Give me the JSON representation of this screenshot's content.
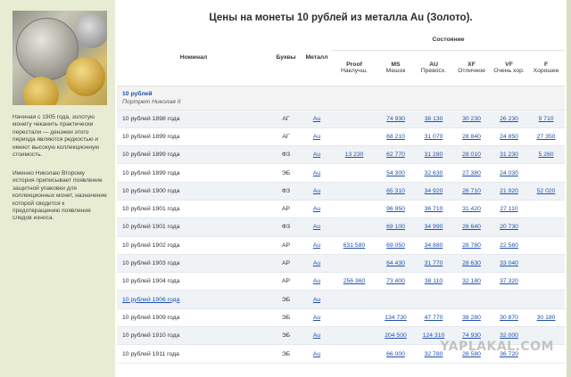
{
  "page_title": "Цены на монеты 10 рублей из металла Au (Золото).",
  "sidebar": {
    "paragraph1": "Начиная с 1905 года, золотую монету чеканить практически перестали — денэжки этого периода являются редкостью и имеют высокую коллекционную стоимость.",
    "paragraph2": "Именно Николаю Второму история приписывает появление защитной упаковки для коллекционных монет, назначение которой сводится к предотвращению появления следов износа."
  },
  "table": {
    "headers": {
      "name": "Номинал",
      "mark": "Буквы",
      "metal": "Металл",
      "state": "Состояние",
      "proof": "Proof",
      "proof_sub": "Наклучш.",
      "ms": "MS",
      "ms_sub": "Мешок",
      "au": "AU",
      "au_sub": "Превосх.",
      "xf": "XF",
      "xf_sub": "Отличное",
      "vf": "VF",
      "vf_sub": "Очень хор.",
      "f": "F",
      "f_sub": "Хорошее"
    },
    "group": {
      "title": "10 рублей",
      "subtitle": "Портрет Николая II"
    },
    "rows": [
      {
        "name": "10 рублей 1898 года",
        "mark": "АГ",
        "metal": "Au",
        "proof": "",
        "ms": "74 930",
        "au": "38 130",
        "xf": "30 230",
        "vf": "26 230",
        "f": "9 710"
      },
      {
        "name": "10 рублей 1899 года",
        "mark": "АГ",
        "metal": "Au",
        "proof": "",
        "ms": "68 210",
        "au": "31 070",
        "xf": "28 840",
        "vf": "24 850",
        "f": "27 350"
      },
      {
        "name": "10 рублей 1899 года",
        "mark": "ФЗ",
        "metal": "Au",
        "proof": "13 230",
        "ms": "62 770",
        "au": "31 280",
        "xf": "28 010",
        "vf": "31 230",
        "f": "5 260"
      },
      {
        "name": "10 рублей 1899 года",
        "mark": "ЭБ",
        "metal": "Au",
        "proof": "",
        "ms": "54 300",
        "au": "32 630",
        "xf": "27 380",
        "vf": "24 030",
        "f": ""
      },
      {
        "name": "10 рублей 1900 года",
        "mark": "ФЗ",
        "metal": "Au",
        "proof": "",
        "ms": "65 310",
        "au": "34 920",
        "xf": "26 710",
        "vf": "21 920",
        "f": "52 020"
      },
      {
        "name": "10 рублей 1901 года",
        "mark": "АР",
        "metal": "Au",
        "proof": "",
        "ms": "96 950",
        "au": "36 710",
        "xf": "31 420",
        "vf": "27 110",
        "f": ""
      },
      {
        "name": "10 рублей 1901 года",
        "mark": "ФЗ",
        "metal": "Au",
        "proof": "",
        "ms": "69 100",
        "au": "34 990",
        "xf": "26 640",
        "vf": "20 730",
        "f": ""
      },
      {
        "name": "10 рублей 1902 года",
        "mark": "АР",
        "metal": "Au",
        "proof": "631 580",
        "ms": "69 050",
        "au": "34 880",
        "xf": "28 780",
        "vf": "22 560",
        "f": ""
      },
      {
        "name": "10 рублей 1903 года",
        "mark": "АР",
        "metal": "Au",
        "proof": "",
        "ms": "64 430",
        "au": "31 770",
        "xf": "28 630",
        "vf": "33 040",
        "f": ""
      },
      {
        "name": "10 рублей 1904 года",
        "mark": "АР",
        "metal": "Au",
        "proof": "256 360",
        "ms": "73 400",
        "au": "38 110",
        "xf": "32 180",
        "vf": "37 320",
        "f": ""
      },
      {
        "name": "10 рублей 1906 года",
        "mark": "ЭБ",
        "metal": "Au",
        "proof": "",
        "ms": "",
        "au": "",
        "xf": "",
        "vf": "",
        "f": "",
        "name_link": true
      },
      {
        "name": "10 рублей 1909 года",
        "mark": "ЭБ",
        "metal": "Au",
        "proof": "",
        "ms": "134 730",
        "au": "47 770",
        "xf": "38 280",
        "vf": "30 870",
        "f": "30 180"
      },
      {
        "name": "10 рублей 1910 года",
        "mark": "ЭБ",
        "metal": "Au",
        "proof": "",
        "ms": "204 500",
        "au": "124 310",
        "xf": "74 930",
        "vf": "32 000",
        "f": ""
      },
      {
        "name": "10 рублей 1911 года",
        "mark": "ЭБ",
        "metal": "Au",
        "proof": "",
        "ms": "66 000",
        "au": "32 780",
        "xf": "28 580",
        "vf": "36 720",
        "f": ""
      }
    ]
  },
  "watermark": "YAPLAKAL.COM"
}
